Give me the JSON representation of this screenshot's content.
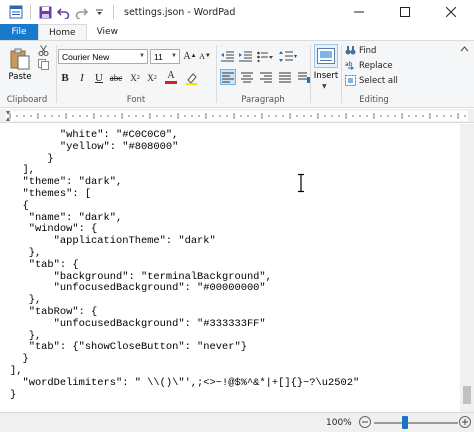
{
  "window": {
    "title": "settings.json - WordPad"
  },
  "tabs": {
    "file": "File",
    "home": "Home",
    "view": "View"
  },
  "ribbon": {
    "clipboard": {
      "paste": "Paste",
      "label": "Clipboard"
    },
    "font": {
      "family": "Courier New",
      "size": "11",
      "label": "Font"
    },
    "paragraph": {
      "label": "Paragraph"
    },
    "insert": {
      "label": "Insert"
    },
    "editing": {
      "find": "Find",
      "replace": "Replace",
      "select_all": "Select all",
      "label": "Editing"
    }
  },
  "document": {
    "lines": [
      "        \"white\": \"#C0C0C0\",",
      "        \"yellow\": \"#808000\"",
      "      }",
      "  ],",
      "  \"theme\": \"dark\",",
      "  \"themes\": [",
      "  {",
      "   \"name\": \"dark\",",
      "   \"window\": {",
      "       \"applicationTheme\": \"dark\"",
      "   },",
      "   \"tab\": {",
      "       \"background\": \"terminalBackground\",",
      "       \"unfocusedBackground\": \"#00000000\"",
      "   },",
      "   \"tabRow\": {",
      "       \"unfocusedBackground\": \"#333333FF\"",
      "   },",
      "   \"tab\": {\"showCloseButton\": \"never\"}",
      "  }",
      "],",
      "  \"wordDelimiters\": \" \\\\()\\\"',;<>~!@$%^&*|+[]{}~?\\u2502\"",
      "}"
    ]
  },
  "status": {
    "zoom": "100%",
    "zoom_level_percent": 100
  },
  "colors": {
    "file_tab": "#1979ca",
    "accent": "#1a73c8",
    "ribbon_bg": "#f5f6f7"
  }
}
